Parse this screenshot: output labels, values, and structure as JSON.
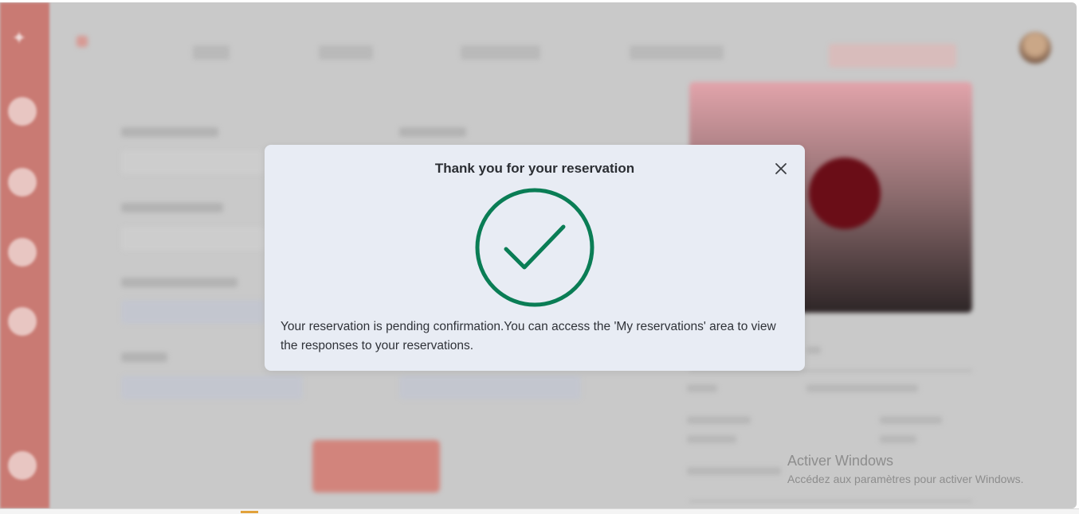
{
  "modal": {
    "title": "Thank you for your reservation",
    "close_icon": "close-icon",
    "status_icon": "check-circle-icon",
    "message": "Your reservation is pending confirmation.You can access the 'My reservations' area to view the responses to your reservations."
  },
  "colors": {
    "success_green": "#0a7d55",
    "modal_background": "#e8ecf4",
    "sidebar": "#c97a73",
    "overlay": "#c9c9c9"
  },
  "watermark": {
    "title": "Activer Windows",
    "subtitle": "Accédez aux paramètres pour activer Windows."
  }
}
